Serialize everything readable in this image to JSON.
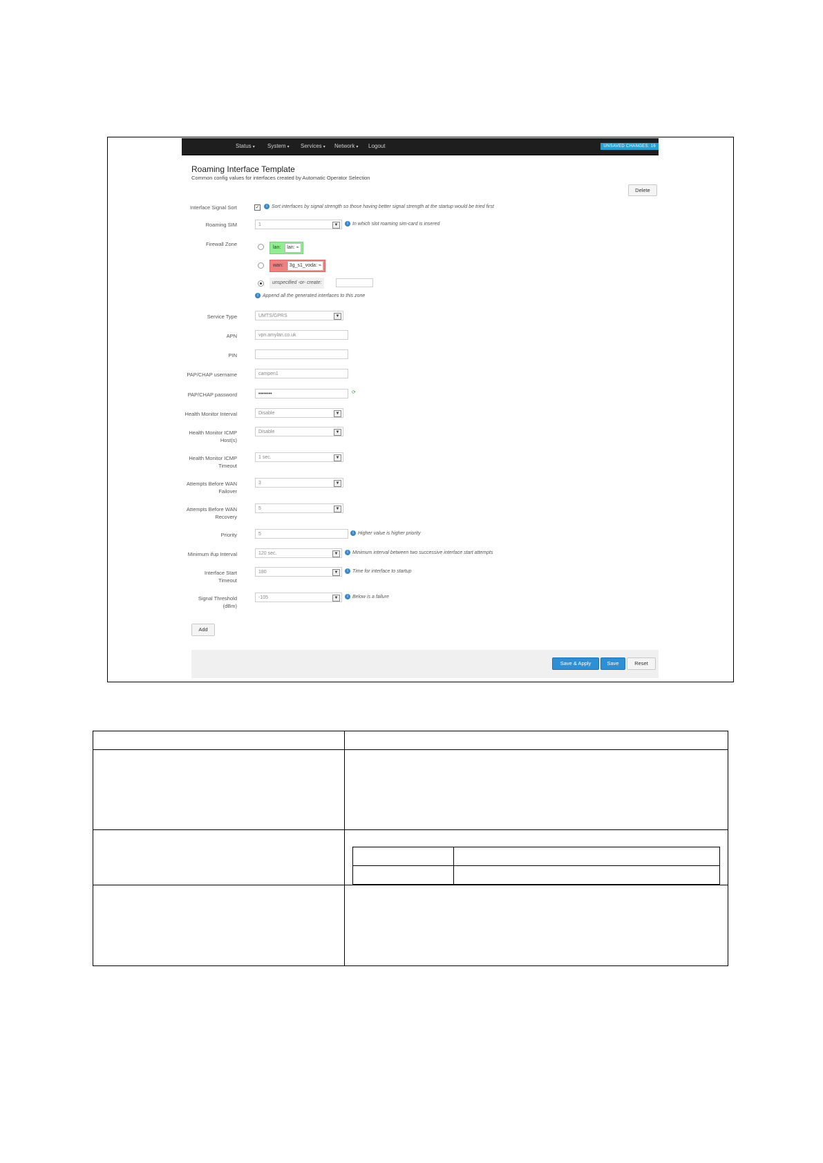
{
  "nav": {
    "items": [
      "Status",
      "System",
      "Services",
      "Network",
      "Logout"
    ],
    "changes": "UNSAVED CHANGES: 16"
  },
  "page": {
    "title": "Roaming Interface Template",
    "subtitle": "Common config values for interfaces created by Automatic Operator Selection",
    "delete_label": "Delete"
  },
  "form": {
    "signal_sort": {
      "label": "Interface Signal Sort",
      "checked": true,
      "hint": "Sort interfaces by signal strength so those having better signal strength at the startup would be tried first"
    },
    "roaming_sim": {
      "label": "Roaming SIM",
      "value": "1",
      "hint": "In which slot roaming sim-card is insered"
    },
    "firewall_zone": {
      "label": "Firewall Zone",
      "zones": [
        {
          "name": "lan:",
          "iface": "lan:",
          "color": "#90ee90",
          "selected": false
        },
        {
          "name": "wan:",
          "iface": "3g_s1_voda:",
          "color": "#f08080",
          "selected": false
        }
      ],
      "unspecified": "unspecified -or- create:",
      "hint": "Append all the generated interfaces to this zone"
    },
    "service_type": {
      "label": "Service Type",
      "value": "UMTS/GPRS"
    },
    "apn": {
      "label": "APN",
      "value": "vpn.amylan.co.uk"
    },
    "pin": {
      "label": "PIN",
      "value": ""
    },
    "username": {
      "label": "PAP/CHAP username",
      "value": "campen1"
    },
    "password": {
      "label": "PAP/CHAP password",
      "value": "••••••••"
    },
    "hm_interval": {
      "label": "Health Monitor Interval",
      "value": "Disable"
    },
    "hm_icmp_host": {
      "label1": "Health Monitor ICMP",
      "label2": "Host(s)",
      "value": "Disable"
    },
    "hm_icmp_timeout": {
      "label1": "Health Monitor ICMP",
      "label2": "Timeout",
      "value": "1 sec."
    },
    "attempts_failover": {
      "label1": "Attempts Before WAN",
      "label2": "Failover",
      "value": "3"
    },
    "attempts_recovery": {
      "label1": "Attempts Before WAN",
      "label2": "Recovery",
      "value": "5"
    },
    "priority": {
      "label": "Priority",
      "value": "5",
      "hint": "Higher value is higher priority"
    },
    "min_ifup": {
      "label": "Minimum ifup Interval",
      "value": "120 sec.",
      "hint": "Minimum interval between two successive interface start attempts"
    },
    "start_timeout": {
      "label1": "Interface Start",
      "label2": "Timeout",
      "value": "180",
      "hint": "Time for interface to startup"
    },
    "signal_threshold": {
      "label1": "Signal Threshold",
      "label2": "(dBm)",
      "value": "-105",
      "hint": "Below is a failure"
    }
  },
  "buttons": {
    "add": "Add",
    "save_apply": "Save & Apply",
    "save": "Save",
    "reset": "Reset"
  },
  "colors": {
    "navbar": "#1e1e1e",
    "accent": "#2f8fd6",
    "changes_badge": "#1fa2d8"
  }
}
